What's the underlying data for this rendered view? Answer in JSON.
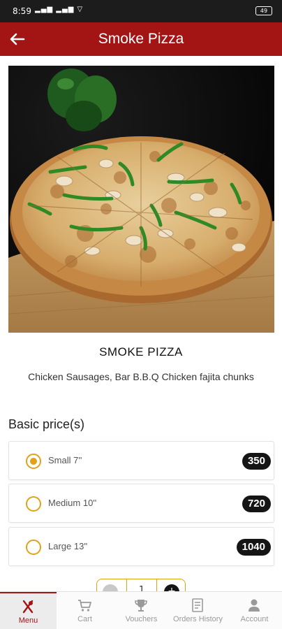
{
  "status_bar": {
    "time": "8:59",
    "signals": "▂▄▆ ▂▄▆ ▽",
    "battery": "49"
  },
  "app_bar": {
    "title": "Smoke Pizza",
    "back_icon": "arrow-left-icon"
  },
  "product": {
    "name": "SMOKE PIZZA",
    "description": "Chicken Sausages, Bar B.B.Q Chicken fajita chunks"
  },
  "prices": {
    "section_title": "Basic price(s)",
    "options": [
      {
        "label": "Small 7''",
        "price": "350",
        "selected": true
      },
      {
        "label": "Medium 10''",
        "price": "720",
        "selected": false
      },
      {
        "label": "Large 13''",
        "price": "1040",
        "selected": false
      }
    ]
  },
  "quantity": {
    "value": "1",
    "plus_symbol": "+"
  },
  "bottom_nav": {
    "items": [
      {
        "label": "Menu",
        "icon": "fork-knife-icon",
        "active": true
      },
      {
        "label": "Cart",
        "icon": "cart-icon",
        "active": false
      },
      {
        "label": "Vouchers",
        "icon": "trophy-icon",
        "active": false
      },
      {
        "label": "Orders History",
        "icon": "receipt-icon",
        "active": false
      },
      {
        "label": "Account",
        "icon": "person-icon",
        "active": false
      }
    ]
  },
  "colors": {
    "brand": "#a31515",
    "accent": "#e0a21b",
    "badge": "#151515"
  }
}
